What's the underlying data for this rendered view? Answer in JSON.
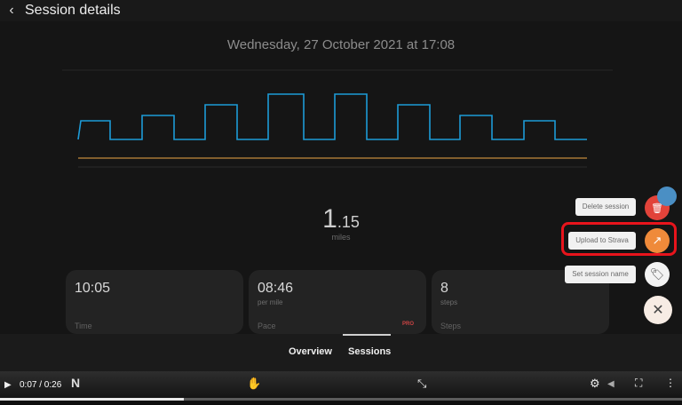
{
  "header": {
    "title": "Session details"
  },
  "session": {
    "date": "Wednesday, 27 October 2021 at 17:08"
  },
  "distance": {
    "whole": "1",
    "decimal": ".15",
    "unit": "miles"
  },
  "stats": {
    "time": {
      "value": "10:05",
      "label": "Time"
    },
    "pace": {
      "value": "08:46",
      "sub": "per mile",
      "label": "Pace",
      "tag": "PRO"
    },
    "steps": {
      "value": "8",
      "sub": "steps",
      "label": "Steps"
    }
  },
  "tabs": [
    "Overview",
    "Sessions"
  ],
  "actions": {
    "delete": "Delete session",
    "upload": "Upload to Strava",
    "rename": "Set session name"
  },
  "player": {
    "time": "0:07 / 0:26",
    "progress": 0.27
  },
  "colors": {
    "speed_line": "#1d9bd7",
    "baseline": "#c48a3c",
    "delete_fab": "#e2433a",
    "upload_fab": "#ef8a3a",
    "highlight": "#e8141c"
  }
}
